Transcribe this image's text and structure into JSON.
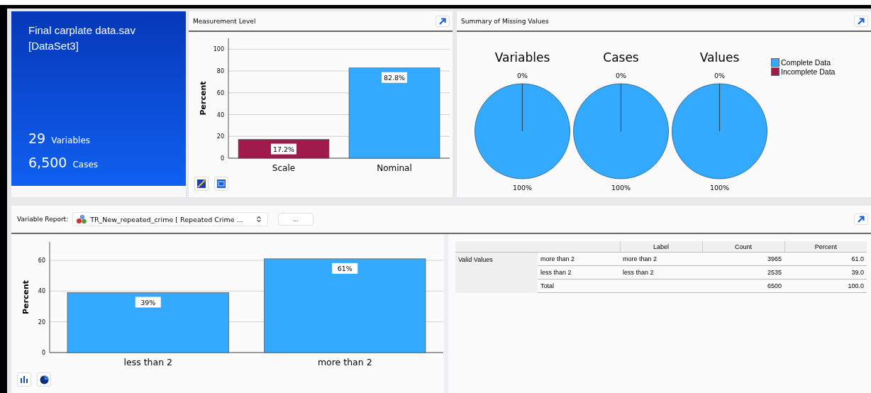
{
  "dataset": {
    "name": "Final carplate data.sav",
    "label": "[DataSet3]",
    "stats": [
      {
        "value": "29",
        "label": "Variables"
      },
      {
        "value": "6,500",
        "label": "Cases"
      }
    ]
  },
  "measurement_level": {
    "title": "Measurement Level",
    "chart_data": {
      "type": "bar",
      "ylabel": "Percent",
      "categories": [
        "Scale",
        "Nominal"
      ],
      "values": [
        17.2,
        82.8
      ],
      "colors": [
        "#a01b4c",
        "#33aaff"
      ],
      "grid": true,
      "ylim": [
        0,
        110
      ],
      "yticks": [
        0,
        20,
        40,
        60,
        80,
        100
      ],
      "value_labels": [
        "17.2%",
        "82.8%"
      ]
    }
  },
  "missing_values": {
    "title": "Summary of Missing Values",
    "chart_data": {
      "type": "pie",
      "categories": [
        "Complete Data",
        "Incomplete Data"
      ],
      "colors": [
        "#33aaff",
        "#a01b4c"
      ],
      "needle": "Complete Data",
      "series": [
        {
          "name": "Variables",
          "values": [
            100,
            0
          ],
          "value_labels": [
            "100%",
            "0%"
          ]
        },
        {
          "name": "Cases",
          "values": [
            100,
            0
          ],
          "value_labels": [
            "100%",
            "0%"
          ]
        },
        {
          "name": "Values",
          "values": [
            100,
            0
          ],
          "value_labels": [
            "100%",
            "0%"
          ]
        }
      ]
    }
  },
  "variable_report": {
    "label": "Variable Report:",
    "variable": "TR_New_repeated_crime  [ Repeated Crime ...",
    "more_button": "...",
    "chart_data": {
      "type": "bar",
      "ylabel": "Percent",
      "categories": [
        "less than 2",
        "more than 2"
      ],
      "values": [
        39,
        61
      ],
      "colors": [
        "#33aaff",
        "#33aaff"
      ],
      "grid": true,
      "ylim": [
        0,
        72
      ],
      "yticks": [
        0,
        20,
        40,
        60
      ],
      "value_labels": [
        "39%",
        "61%"
      ]
    },
    "table": {
      "columns": [
        "Label",
        "Count",
        "Percent"
      ],
      "group": "Valid Values",
      "rows": [
        {
          "value": "more than 2",
          "label": "more than 2",
          "count": "3965",
          "percent": "61.0"
        },
        {
          "value": "less than 2",
          "label": "less than 2",
          "count": "2535",
          "percent": "39.0"
        },
        {
          "value": "Total",
          "count": "6500",
          "percent": "100.0"
        }
      ]
    }
  }
}
